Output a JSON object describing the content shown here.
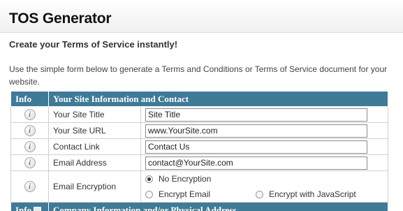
{
  "header": {
    "title": "TOS Generator"
  },
  "subtitle": "Create your Terms of Service instantly!",
  "intro": "Use the simple form below to generate a Terms and Conditions or Terms of Service document for your website.",
  "table": {
    "col_info": "Info",
    "col_section": "Your Site Information and Contact",
    "rows": [
      {
        "label": "Your Site Title",
        "value": "Site Title"
      },
      {
        "label": "Your Site URL",
        "value": "www.YourSite.com"
      },
      {
        "label": "Contact Link",
        "value": "Contact Us"
      },
      {
        "label": "Email Address",
        "value": "contact@YourSite.com"
      }
    ],
    "encryption": {
      "label": "Email Encryption",
      "options": [
        {
          "label": "No Encryption",
          "selected": true
        },
        {
          "label": "Encrypt Email",
          "selected": false
        },
        {
          "label": "Encrypt with JavaScript",
          "selected": false
        }
      ]
    },
    "next_section": {
      "col_info": "Info",
      "col_section": "Company Information and/or Physical Address"
    }
  },
  "icons": {
    "info": "info-icon"
  },
  "colors": {
    "header_bg": "#3f7a96",
    "page_bg": "#ffffff"
  }
}
